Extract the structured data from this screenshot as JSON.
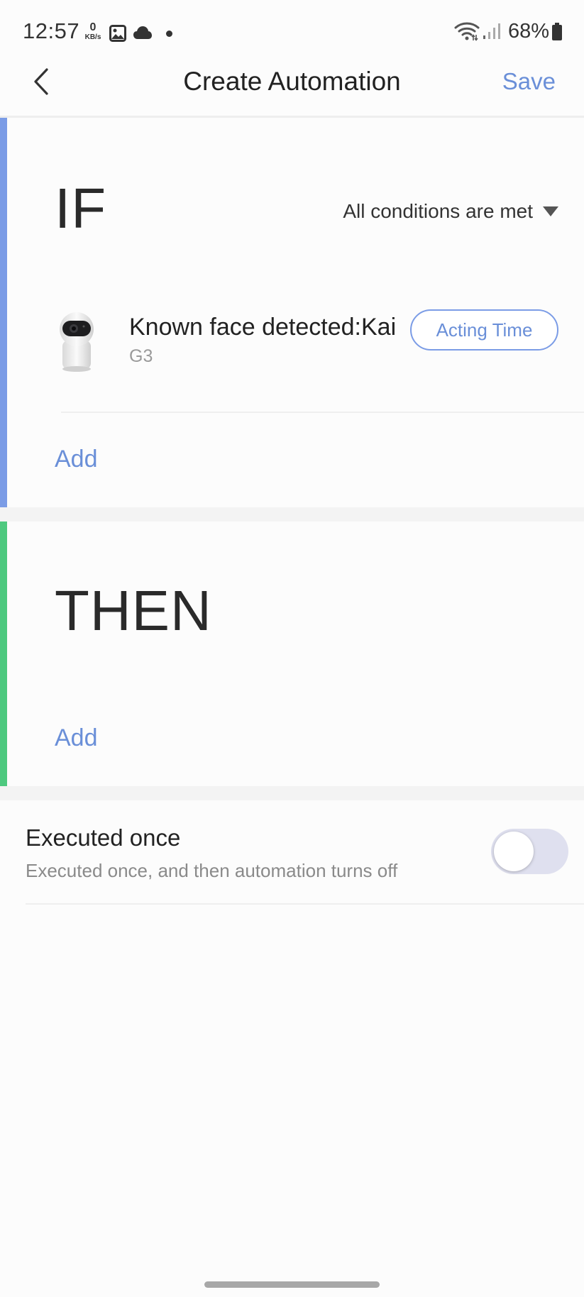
{
  "status_bar": {
    "time": "12:57",
    "net_speed_value": "0",
    "net_speed_unit": "KB/s",
    "battery": "68%",
    "icons": [
      "gallery-icon",
      "cloud-icon",
      "notification-dot",
      "wifi-icon",
      "signal-icon",
      "battery-icon"
    ]
  },
  "header": {
    "title": "Create Automation",
    "save_label": "Save",
    "back_icon": "chevron-left-icon"
  },
  "if_section": {
    "heading": "IF",
    "condition_mode": "All conditions are met",
    "conditions": [
      {
        "title": "Known face detected:Kai",
        "device": "G3",
        "device_icon": "camera-device-icon",
        "action_label": "Acting Time"
      }
    ],
    "add_label": "Add"
  },
  "then_section": {
    "heading": "THEN",
    "add_label": "Add"
  },
  "executed_once": {
    "title": "Executed once",
    "description": "Executed once, and then automation turns off",
    "enabled": false
  },
  "colors": {
    "accent_blue": "#6a8fd8",
    "if_bar": "#7b9ce6",
    "then_bar": "#4ec97f",
    "toggle_off": "#dfe0ef"
  }
}
